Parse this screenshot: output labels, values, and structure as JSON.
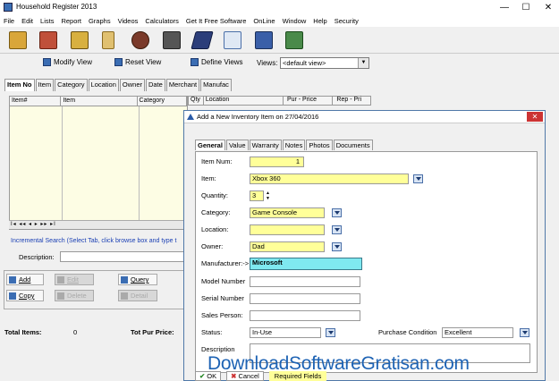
{
  "window": {
    "title": "Household Register 2013",
    "min": "—",
    "max": "☐",
    "close": "✕"
  },
  "menu": [
    "File",
    "Edit",
    "Lists",
    "Report",
    "Graphs",
    "Videos",
    "Calculators",
    "Get It Free Software",
    "OnLine",
    "Window",
    "Help",
    "Security"
  ],
  "toolbar": [
    "clipboard-icon",
    "house-icon",
    "boxes-icon",
    "book-icon",
    "people-icon",
    "projector-icon",
    "notepad-icon",
    "window-icon",
    "save-icon",
    "exit-icon"
  ],
  "viewbar": {
    "modify": "Modify View",
    "reset": "Reset View",
    "define": "Define Views",
    "views_label": "Views:",
    "views_value": "<default view>"
  },
  "main_tabs": [
    "Item No",
    "Item",
    "Category",
    "Location",
    "Owner",
    "Date",
    "Merchant",
    "Manufac"
  ],
  "grid_columns": [
    "Item#",
    "Item",
    "Category",
    "Qty",
    "Location",
    "Pur - Price",
    "Rep - Pri"
  ],
  "nav_glyphs": "I◂ ◂◂ ◂ ▸ ▸▸ ▸I",
  "incremental_search": "Incremental Search (Select Tab, click browse box and type t",
  "description_label": "Description:",
  "buttons": {
    "add": "Add",
    "edit": "Edit",
    "query": "Query",
    "copy": "Copy",
    "delete": "Delete",
    "detail": "Detail"
  },
  "totals": {
    "items_label": "Total Items:",
    "items_value": "0",
    "pur_price_label": "Tot Pur Price:"
  },
  "dialog": {
    "title": "Add a New Inventory Item on 27/04/2016",
    "close": "✕",
    "tabs": [
      "General",
      "Value",
      "Warranty",
      "Notes",
      "Photos",
      "Documents"
    ],
    "fields": {
      "item_num_label": "Item Num:",
      "item_num": "1",
      "item_label": "Item:",
      "item": "Xbox 360",
      "quantity_label": "Quantity:",
      "quantity": "3",
      "category_label": "Category:",
      "category": "Game Console",
      "location_label": "Location:",
      "location": "",
      "owner_label": "Owner:",
      "owner": "Dad",
      "manufacturer_label": "Manufacturer:->",
      "manufacturer": "Microsoft",
      "model_label": "Model Number",
      "model": "",
      "serial_label": "Serial Number",
      "serial": "",
      "sales_label": "Sales Person:",
      "sales": "",
      "status_label": "Status:",
      "status": "In-Use",
      "condition_label": "Purchase Condition",
      "condition": "Excellent",
      "description_label": "Description",
      "description": ""
    },
    "footer": {
      "ok": "OK",
      "cancel": "Cancel",
      "required": "Required Fields"
    }
  },
  "watermark": "DownloadSoftwareGratisan.com",
  "colors": {
    "required_yellow": "#ffff99",
    "highlight_cyan": "#7fe9f0",
    "link_blue": "#1a3fb4"
  }
}
